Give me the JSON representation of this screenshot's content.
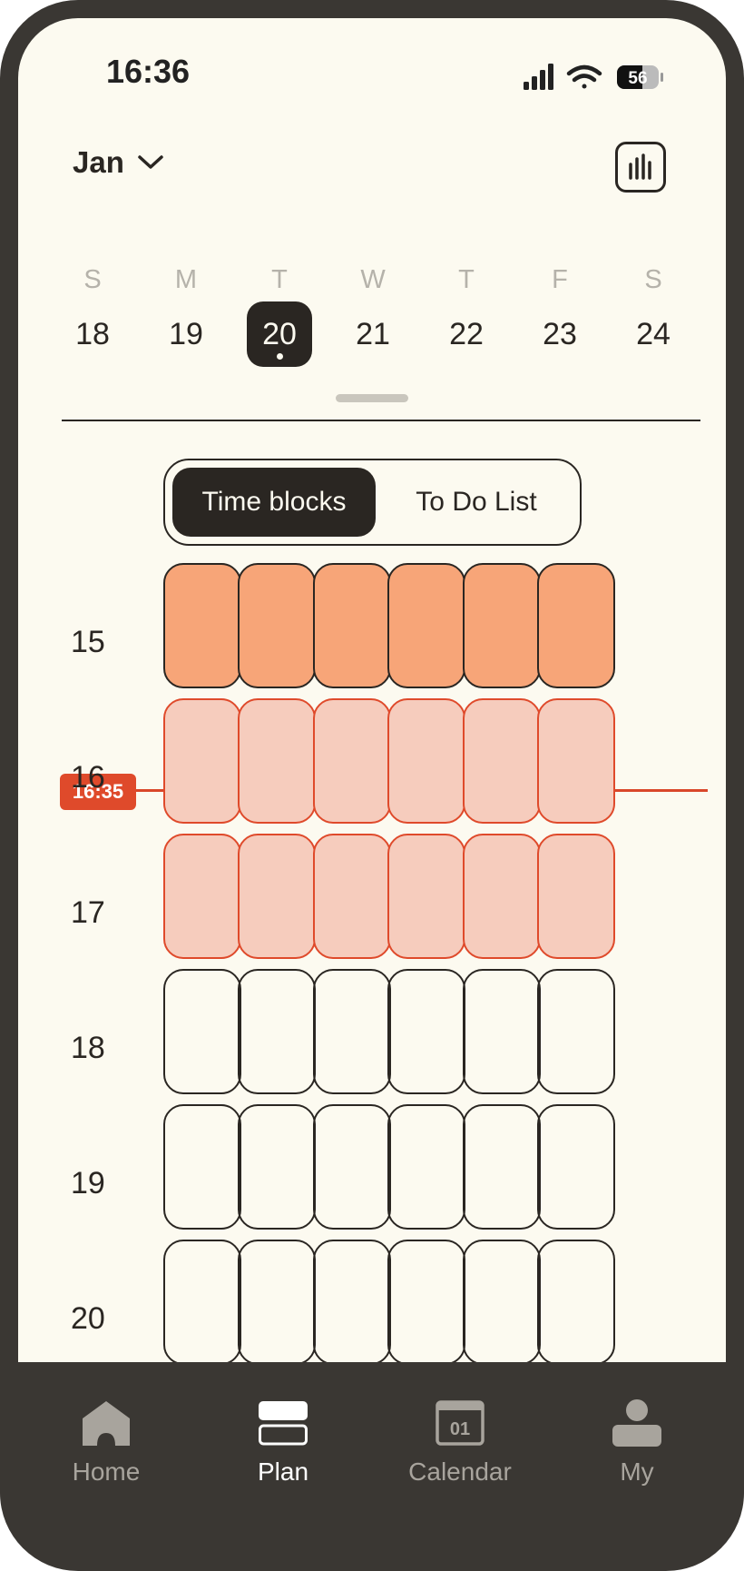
{
  "status_bar": {
    "time": "16:36",
    "battery": "56"
  },
  "header": {
    "month": "Jan",
    "month_icon": "chevron-down-icon",
    "stats_icon": "bar-chart-icon"
  },
  "week": {
    "days_of_week": [
      "S",
      "M",
      "T",
      "W",
      "T",
      "F",
      "S"
    ],
    "dates": [
      "18",
      "19",
      "20",
      "21",
      "22",
      "23",
      "24"
    ],
    "selected_index": 2
  },
  "segmented": {
    "time_blocks": "Time blocks",
    "todo": "To Do List",
    "active": "time_blocks"
  },
  "timeline": {
    "hours": [
      "15",
      "16",
      "17",
      "18",
      "19",
      "20"
    ],
    "current_time": "16:35",
    "row_states": [
      "filled",
      "current",
      "current",
      "empty",
      "empty",
      "empty"
    ],
    "blocks_per_hour": 6
  },
  "colors": {
    "background": "#fcfaf0",
    "filled": "#f7a578",
    "current": "#f6ccbd",
    "accent": "#df4a2b",
    "dark": "#2a2622"
  },
  "tabbar": {
    "tabs": [
      {
        "label": "Home",
        "icon": "home-icon"
      },
      {
        "label": "Plan",
        "icon": "plan-icon"
      },
      {
        "label": "Calendar",
        "icon": "calendar-icon",
        "icon_text": "01"
      },
      {
        "label": "My",
        "icon": "person-icon"
      }
    ],
    "active_index": 1
  }
}
